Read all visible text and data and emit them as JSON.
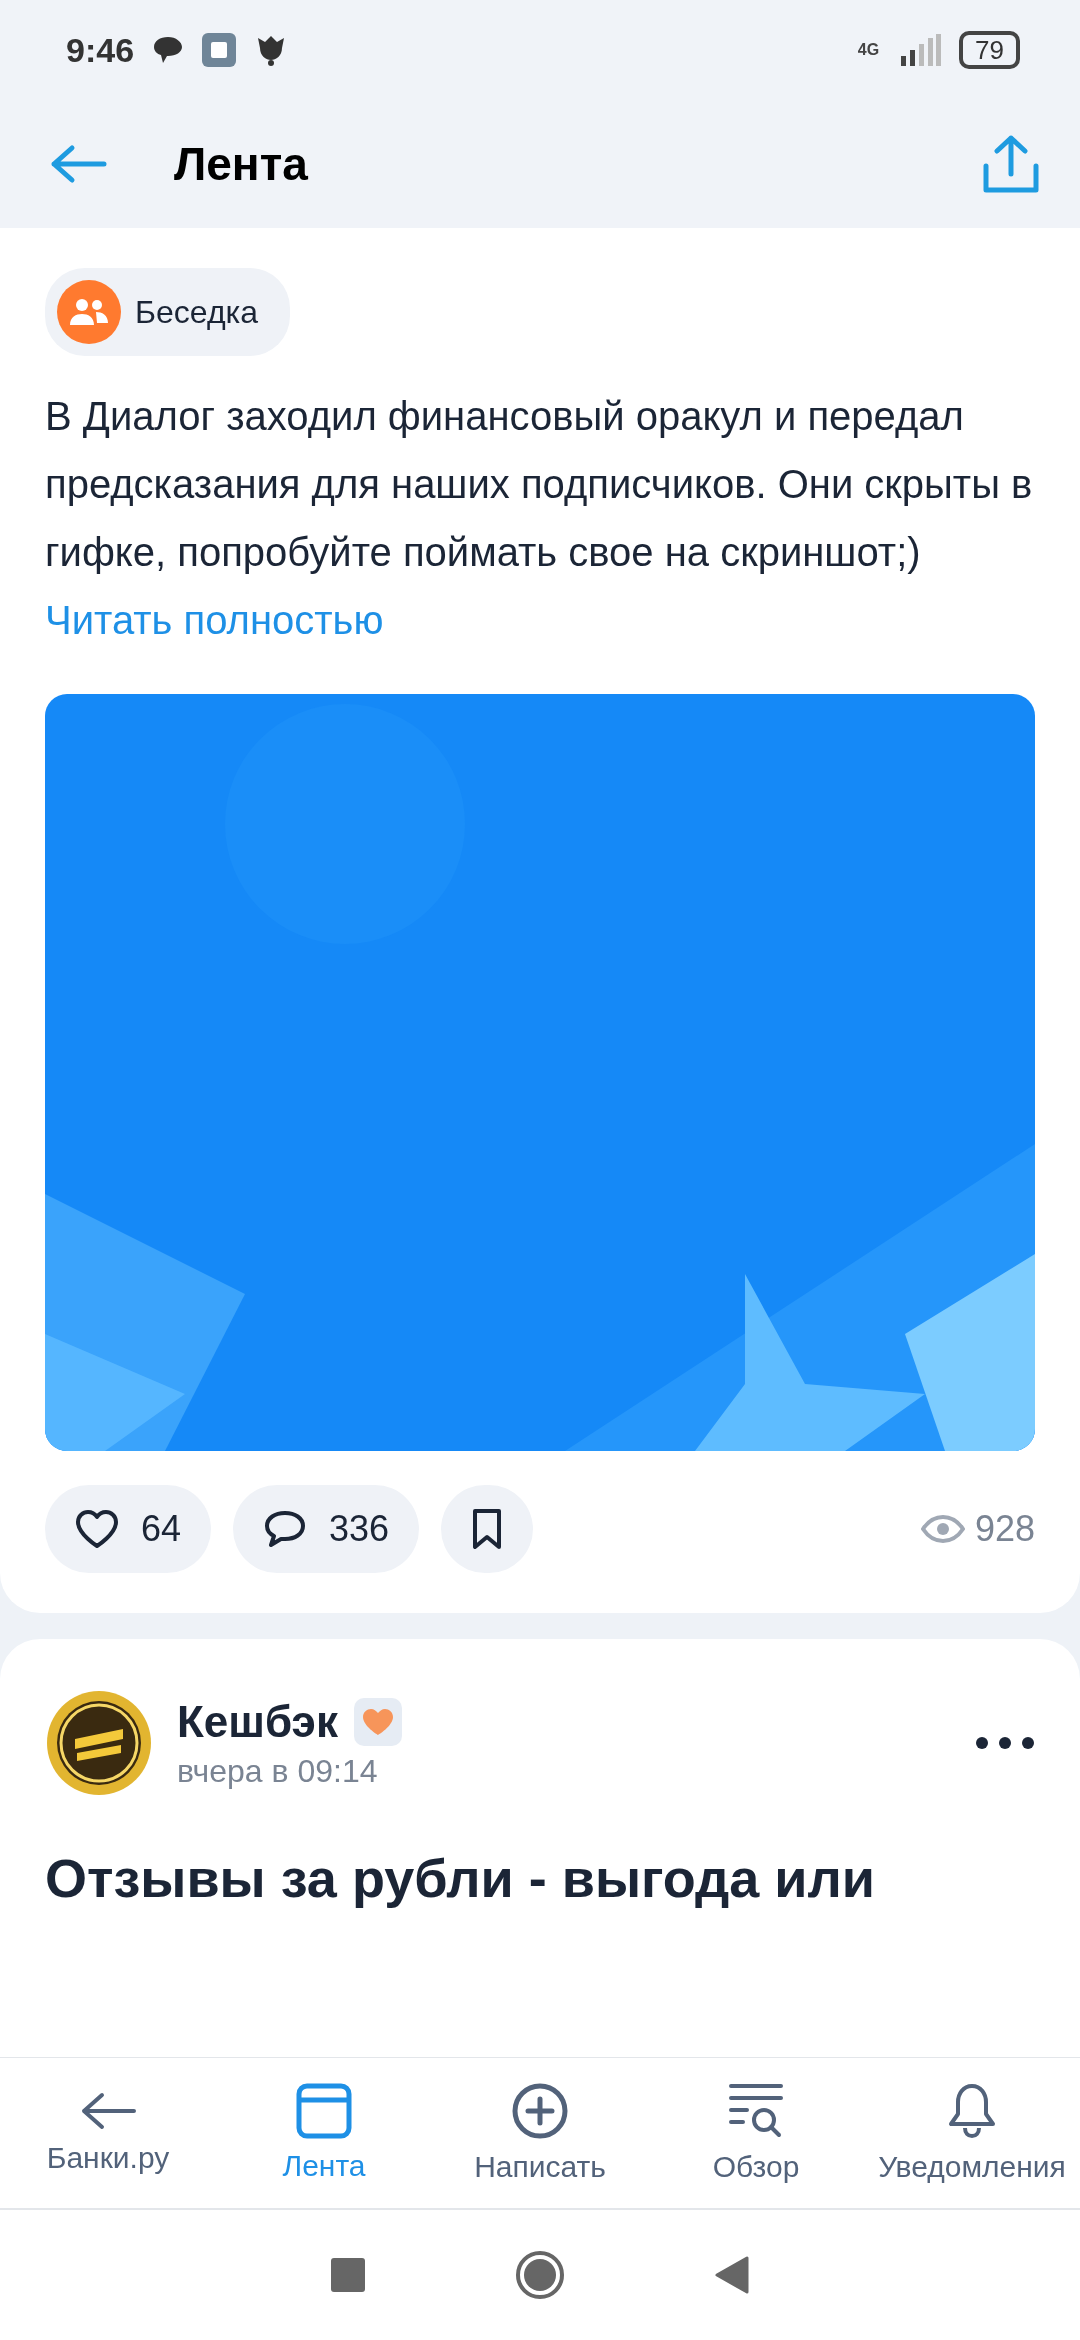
{
  "status_bar": {
    "time": "9:46",
    "network": "4G",
    "battery": "79"
  },
  "header": {
    "title": "Лента"
  },
  "post": {
    "community": "Беседка",
    "text": "В Диалог заходил финансовый оракул и передал предсказания для наших подписчиков. Они скрыты в гифке, попробуйте поймать свое на скриншот;)",
    "read_more": "Читать полностью",
    "likes": "64",
    "comments": "336",
    "bookmarked": false,
    "views": "928"
  },
  "next_post": {
    "author": "Кешбэк",
    "time": "вчера в 09:14",
    "title": "Отзывы за рубли - выгода или"
  },
  "bottom_nav": [
    {
      "label": "Банки.ру",
      "kind": "back",
      "selected": false
    },
    {
      "label": "Лента",
      "kind": "feed",
      "selected": true
    },
    {
      "label": "Написать",
      "kind": "plus",
      "selected": false
    },
    {
      "label": "Обзор",
      "kind": "search-list",
      "selected": false
    },
    {
      "label": "Уведомления",
      "kind": "bell",
      "selected": false
    }
  ]
}
